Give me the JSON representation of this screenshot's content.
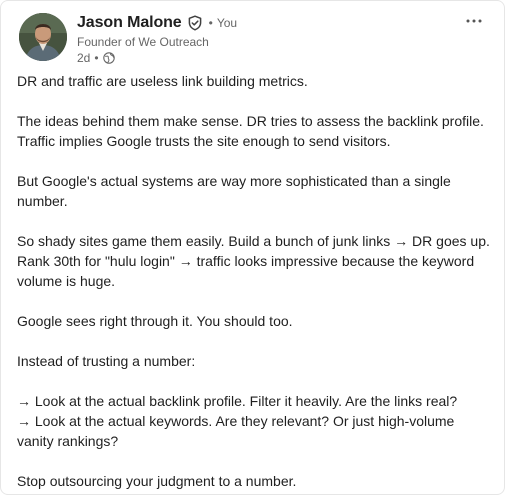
{
  "author": {
    "name": "Jason Malone",
    "connection": "You",
    "headline": "Founder of We Outreach",
    "time": "2d",
    "verified_icon": "verified-shield-icon",
    "visibility_icon": "globe-icon"
  },
  "menu": {
    "more_icon": "more-horizontal-icon"
  },
  "post": {
    "paragraphs": [
      "DR and traffic are useless link building metrics.",
      "The ideas behind them make sense. DR tries to assess the backlink profile. Traffic implies Google trusts the site enough to send visitors.",
      "But Google's actual systems are way more sophisticated than a single number.",
      "So shady sites game them easily. Build a bunch of junk links → DR goes up. Rank 30th for \"hulu login\" → traffic looks impressive because the keyword volume is huge.",
      "Google sees right through it. You should too.",
      "Instead of trusting a number:",
      "→ Look at the actual backlink profile. Filter it heavily. Are the links real?\n→ Look at the actual keywords. Are they relevant? Or just high-volume vanity rankings?",
      "Stop outsourcing your judgment to a number."
    ]
  },
  "colors": {
    "text": "#1f1f1f",
    "secondary_text": "#666666",
    "border": "#e6e6e6"
  }
}
